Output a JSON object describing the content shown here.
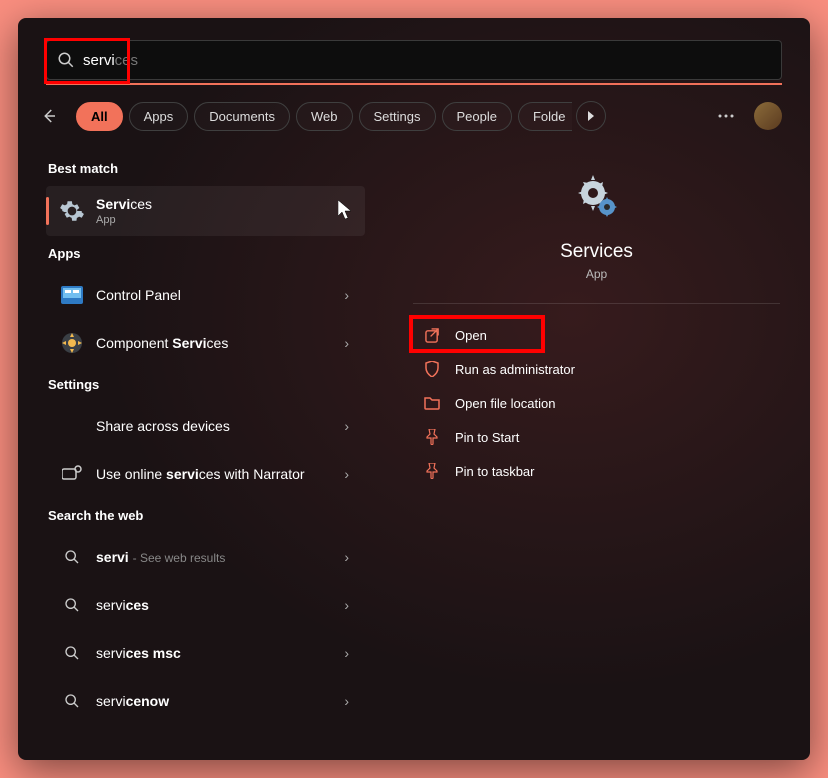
{
  "search": {
    "typed": "servi",
    "suggested": "ces"
  },
  "filters": {
    "active": "All",
    "items": [
      "Apps",
      "Documents",
      "Web",
      "Settings",
      "People",
      "Folde"
    ]
  },
  "sections": {
    "bestMatch": "Best match",
    "apps": "Apps",
    "settings": "Settings",
    "web": "Search the web"
  },
  "results": {
    "bestMatch": {
      "titleBold": "Servi",
      "titleRest": "ces",
      "subtitle": "App"
    },
    "apps": [
      {
        "label": "Control Panel"
      },
      {
        "labelPre": "Component ",
        "labelBold": "Servi",
        "labelPost": "ces"
      }
    ],
    "settings": [
      {
        "labelBold": "",
        "label": "Share across devices"
      },
      {
        "labelPre": "Use online ",
        "labelBold": "servi",
        "labelPost": "ces with Narrator"
      }
    ],
    "web": [
      {
        "labelBold": "servi",
        "labelRest": "",
        "hint": "See web results"
      },
      {
        "labelBold": "servi",
        "labelRest": "ces"
      },
      {
        "labelBold": "servi",
        "labelRest": "ces msc"
      },
      {
        "labelBold": "servi",
        "labelRest": "cenow"
      }
    ]
  },
  "detail": {
    "title": "Services",
    "type": "App",
    "actions": [
      {
        "icon": "open",
        "label": "Open"
      },
      {
        "icon": "shield",
        "label": "Run as administrator"
      },
      {
        "icon": "folder",
        "label": "Open file location"
      },
      {
        "icon": "pin",
        "label": "Pin to Start"
      },
      {
        "icon": "pin",
        "label": "Pin to taskbar"
      }
    ]
  }
}
